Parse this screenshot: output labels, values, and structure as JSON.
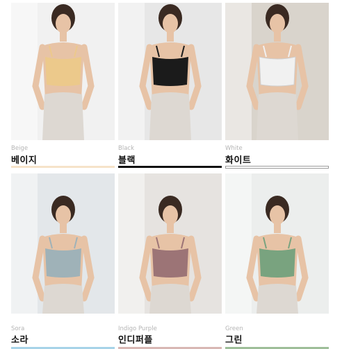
{
  "colors": [
    {
      "en": "Beige",
      "ko": "베이지",
      "swatch": "#f6e3c9",
      "top": "#ecc98b",
      "bg": "#f1f1f1",
      "outline": false
    },
    {
      "en": "Black",
      "ko": "블랙",
      "swatch": "#111111",
      "top": "#1b1b1b",
      "bg": "#e7e7e7",
      "outline": false
    },
    {
      "en": "White",
      "ko": "화이트",
      "swatch": "#ffffff",
      "top": "#f1f1f1",
      "bg": "#d9d4cc",
      "outline": true
    },
    {
      "en": "Sora",
      "ko": "소라",
      "swatch": "#a7d3e8",
      "top": "#9fb2b8",
      "bg": "#e3e7ea",
      "outline": false
    },
    {
      "en": "Indigo Purple",
      "ko": "인디퍼플",
      "swatch": "#d8b7b4",
      "top": "#9c7476",
      "bg": "#e6e3e0",
      "outline": false
    },
    {
      "en": "Green",
      "ko": "그린",
      "swatch": "#9ebe99",
      "top": "#79a37f",
      "bg": "#eceeed",
      "outline": false
    }
  ]
}
